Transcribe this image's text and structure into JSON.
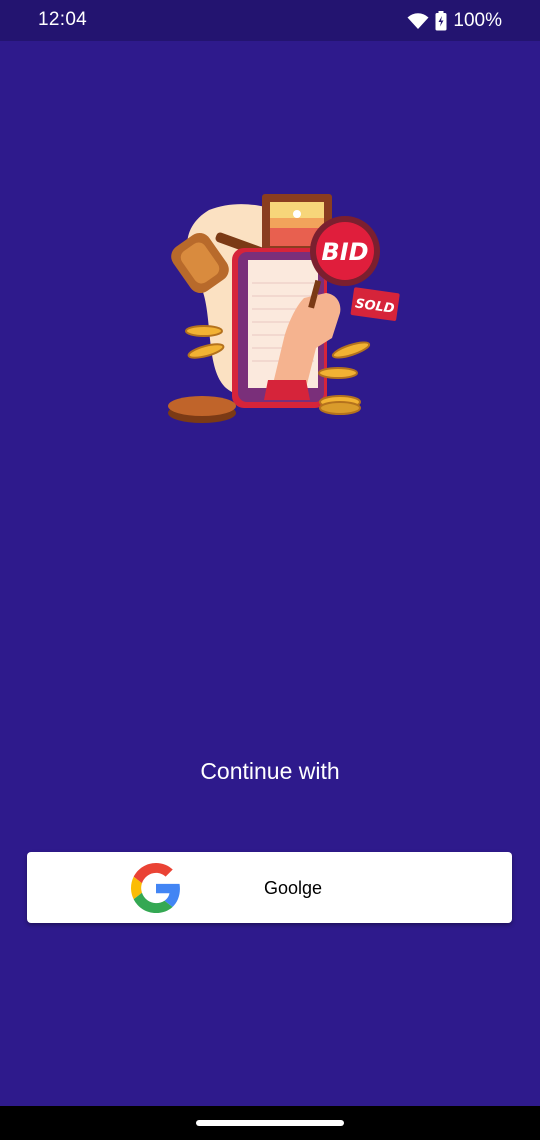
{
  "status_bar": {
    "time": "12:04",
    "battery": "100%",
    "icons": [
      "wifi-icon",
      "battery-icon"
    ]
  },
  "illustration": {
    "bid_sign": "BID",
    "sold_tag": "SOLD"
  },
  "login": {
    "prompt": "Continue with",
    "google_button_label": "Goolge"
  },
  "colors": {
    "background": "#2e1a8c",
    "status_bar": "#231470",
    "button_bg": "#ffffff"
  }
}
